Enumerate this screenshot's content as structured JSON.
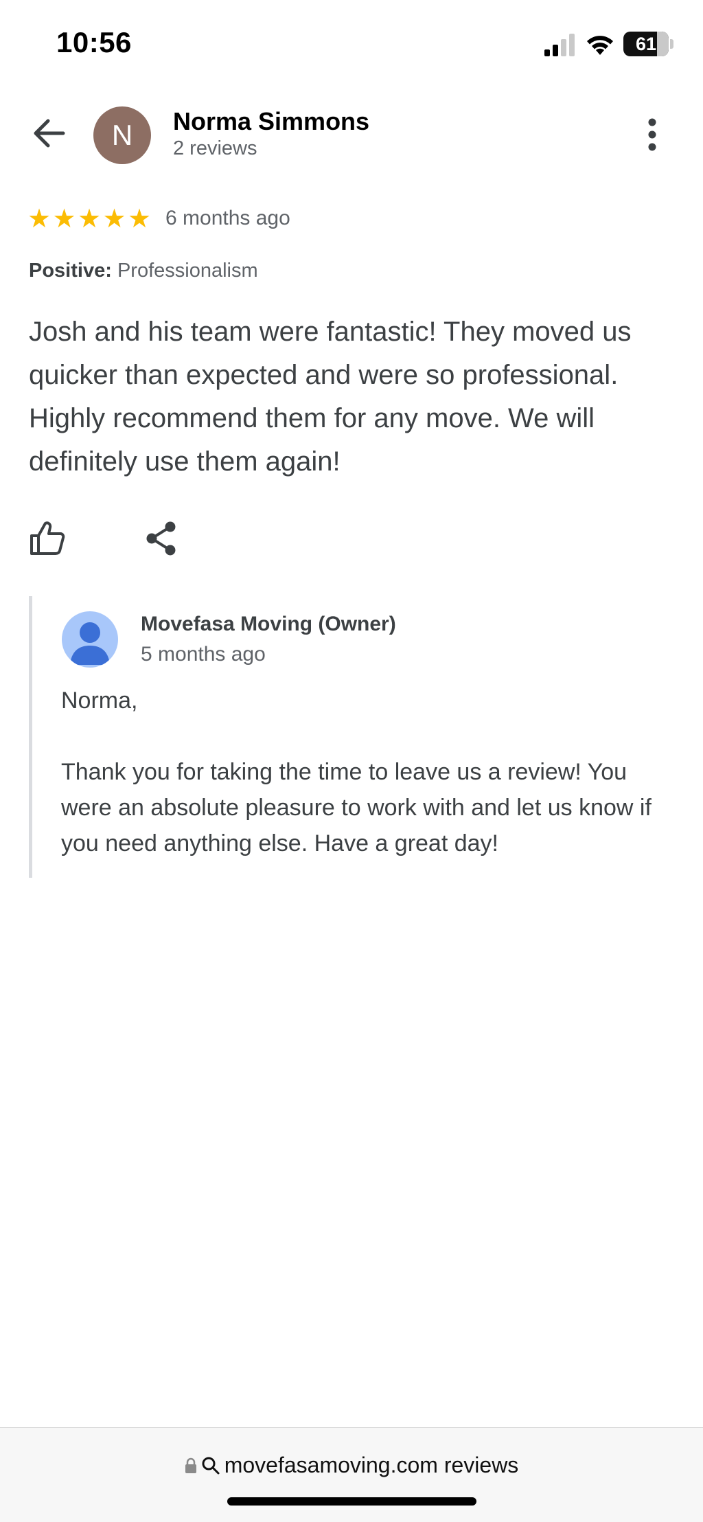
{
  "status_bar": {
    "time": "10:56",
    "battery_level": "61",
    "icons": [
      "signal-icon",
      "wifi-icon",
      "battery-icon"
    ]
  },
  "header": {
    "avatar_initial": "N",
    "avatar_color": "#8d6e63",
    "reviewer_name": "Norma Simmons",
    "review_count": "2 reviews",
    "icons": [
      "back-arrow-icon",
      "more-vert-icon"
    ]
  },
  "review": {
    "rating": 5,
    "stars": [
      "★",
      "★",
      "★",
      "★",
      "★"
    ],
    "star_color": "#fbbc04",
    "time": "6 months ago",
    "positive_label": "Positive:",
    "positive_value": "Professionalism",
    "text": "Josh and his team were fantastic! They moved us quicker than expected and were so professional. Highly recommend them for any move. We will definitely use them again!",
    "actions": [
      "thumbs-up-icon",
      "share-icon"
    ]
  },
  "owner_reply": {
    "name": "Movefasa Moving (Owner)",
    "time": "5 months ago",
    "text": "Norma,\n\nThank you for taking the time to leave us a review! You were an absolute pleasure to work with and let us know if you need anything else. Have a great day!",
    "avatar_color": "#a8c7fa"
  },
  "browser": {
    "url": "movefasamoving.com reviews",
    "icons": [
      "lock-icon",
      "search-icon"
    ]
  }
}
